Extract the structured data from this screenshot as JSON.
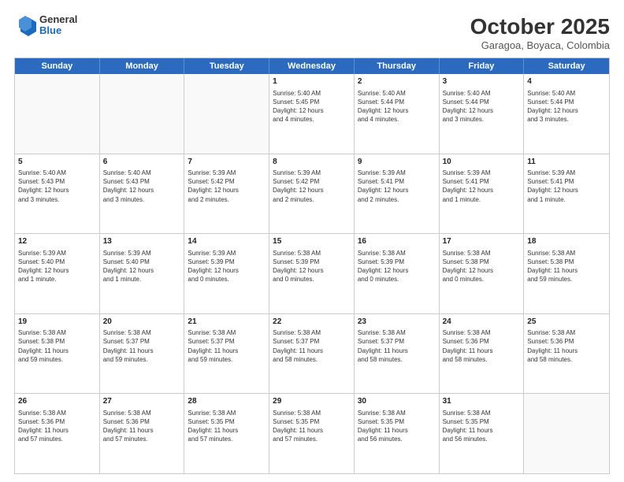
{
  "header": {
    "logo": {
      "general": "General",
      "blue": "Blue"
    },
    "title": "October 2025",
    "location": "Garagoa, Boyaca, Colombia"
  },
  "weekdays": [
    "Sunday",
    "Monday",
    "Tuesday",
    "Wednesday",
    "Thursday",
    "Friday",
    "Saturday"
  ],
  "rows": [
    [
      {
        "day": "",
        "info": ""
      },
      {
        "day": "",
        "info": ""
      },
      {
        "day": "",
        "info": ""
      },
      {
        "day": "1",
        "info": "Sunrise: 5:40 AM\nSunset: 5:45 PM\nDaylight: 12 hours\nand 4 minutes."
      },
      {
        "day": "2",
        "info": "Sunrise: 5:40 AM\nSunset: 5:44 PM\nDaylight: 12 hours\nand 4 minutes."
      },
      {
        "day": "3",
        "info": "Sunrise: 5:40 AM\nSunset: 5:44 PM\nDaylight: 12 hours\nand 3 minutes."
      },
      {
        "day": "4",
        "info": "Sunrise: 5:40 AM\nSunset: 5:44 PM\nDaylight: 12 hours\nand 3 minutes."
      }
    ],
    [
      {
        "day": "5",
        "info": "Sunrise: 5:40 AM\nSunset: 5:43 PM\nDaylight: 12 hours\nand 3 minutes."
      },
      {
        "day": "6",
        "info": "Sunrise: 5:40 AM\nSunset: 5:43 PM\nDaylight: 12 hours\nand 3 minutes."
      },
      {
        "day": "7",
        "info": "Sunrise: 5:39 AM\nSunset: 5:42 PM\nDaylight: 12 hours\nand 2 minutes."
      },
      {
        "day": "8",
        "info": "Sunrise: 5:39 AM\nSunset: 5:42 PM\nDaylight: 12 hours\nand 2 minutes."
      },
      {
        "day": "9",
        "info": "Sunrise: 5:39 AM\nSunset: 5:41 PM\nDaylight: 12 hours\nand 2 minutes."
      },
      {
        "day": "10",
        "info": "Sunrise: 5:39 AM\nSunset: 5:41 PM\nDaylight: 12 hours\nand 1 minute."
      },
      {
        "day": "11",
        "info": "Sunrise: 5:39 AM\nSunset: 5:41 PM\nDaylight: 12 hours\nand 1 minute."
      }
    ],
    [
      {
        "day": "12",
        "info": "Sunrise: 5:39 AM\nSunset: 5:40 PM\nDaylight: 12 hours\nand 1 minute."
      },
      {
        "day": "13",
        "info": "Sunrise: 5:39 AM\nSunset: 5:40 PM\nDaylight: 12 hours\nand 1 minute."
      },
      {
        "day": "14",
        "info": "Sunrise: 5:39 AM\nSunset: 5:39 PM\nDaylight: 12 hours\nand 0 minutes."
      },
      {
        "day": "15",
        "info": "Sunrise: 5:38 AM\nSunset: 5:39 PM\nDaylight: 12 hours\nand 0 minutes."
      },
      {
        "day": "16",
        "info": "Sunrise: 5:38 AM\nSunset: 5:39 PM\nDaylight: 12 hours\nand 0 minutes."
      },
      {
        "day": "17",
        "info": "Sunrise: 5:38 AM\nSunset: 5:38 PM\nDaylight: 12 hours\nand 0 minutes."
      },
      {
        "day": "18",
        "info": "Sunrise: 5:38 AM\nSunset: 5:38 PM\nDaylight: 11 hours\nand 59 minutes."
      }
    ],
    [
      {
        "day": "19",
        "info": "Sunrise: 5:38 AM\nSunset: 5:38 PM\nDaylight: 11 hours\nand 59 minutes."
      },
      {
        "day": "20",
        "info": "Sunrise: 5:38 AM\nSunset: 5:37 PM\nDaylight: 11 hours\nand 59 minutes."
      },
      {
        "day": "21",
        "info": "Sunrise: 5:38 AM\nSunset: 5:37 PM\nDaylight: 11 hours\nand 59 minutes."
      },
      {
        "day": "22",
        "info": "Sunrise: 5:38 AM\nSunset: 5:37 PM\nDaylight: 11 hours\nand 58 minutes."
      },
      {
        "day": "23",
        "info": "Sunrise: 5:38 AM\nSunset: 5:37 PM\nDaylight: 11 hours\nand 58 minutes."
      },
      {
        "day": "24",
        "info": "Sunrise: 5:38 AM\nSunset: 5:36 PM\nDaylight: 11 hours\nand 58 minutes."
      },
      {
        "day": "25",
        "info": "Sunrise: 5:38 AM\nSunset: 5:36 PM\nDaylight: 11 hours\nand 58 minutes."
      }
    ],
    [
      {
        "day": "26",
        "info": "Sunrise: 5:38 AM\nSunset: 5:36 PM\nDaylight: 11 hours\nand 57 minutes."
      },
      {
        "day": "27",
        "info": "Sunrise: 5:38 AM\nSunset: 5:36 PM\nDaylight: 11 hours\nand 57 minutes."
      },
      {
        "day": "28",
        "info": "Sunrise: 5:38 AM\nSunset: 5:35 PM\nDaylight: 11 hours\nand 57 minutes."
      },
      {
        "day": "29",
        "info": "Sunrise: 5:38 AM\nSunset: 5:35 PM\nDaylight: 11 hours\nand 57 minutes."
      },
      {
        "day": "30",
        "info": "Sunrise: 5:38 AM\nSunset: 5:35 PM\nDaylight: 11 hours\nand 56 minutes."
      },
      {
        "day": "31",
        "info": "Sunrise: 5:38 AM\nSunset: 5:35 PM\nDaylight: 11 hours\nand 56 minutes."
      },
      {
        "day": "",
        "info": ""
      }
    ]
  ]
}
